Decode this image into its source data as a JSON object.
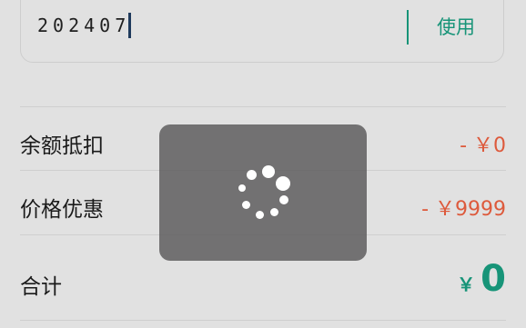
{
  "coupon": {
    "code_value": "202407",
    "use_label": "使用"
  },
  "rows": {
    "balance_deduction": {
      "label": "余额抵扣",
      "value": "- ￥0"
    },
    "price_discount": {
      "label": "价格优惠",
      "value": "- ￥9999"
    },
    "total": {
      "label": "合计",
      "currency": "￥",
      "amount": "0"
    }
  },
  "colors": {
    "accent": "#179478",
    "deduction": "#dd5a3c",
    "overlay": "#605e5f"
  },
  "loading": {
    "icon": "loading-spinner-icon"
  }
}
